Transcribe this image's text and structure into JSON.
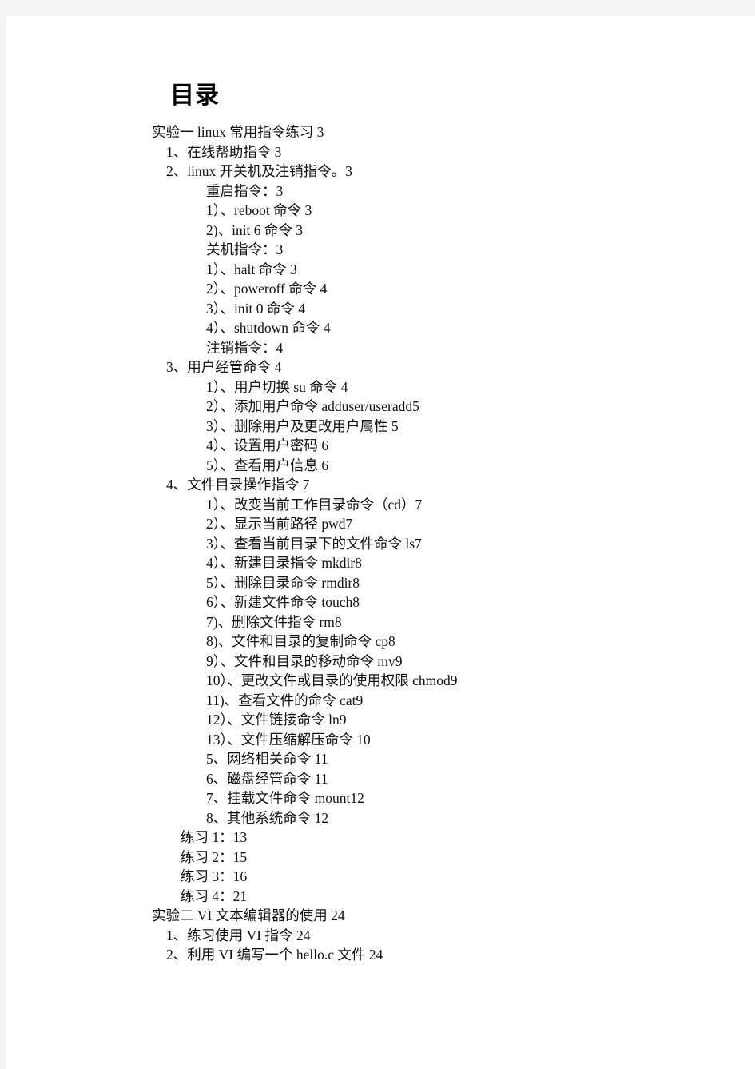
{
  "document": {
    "title": "目录"
  },
  "toc": {
    "entries": [
      {
        "level": 1,
        "text": "实验一 linux 常用指令练习 3"
      },
      {
        "level": 2,
        "text": "1、在线帮助指令 3"
      },
      {
        "level": 2,
        "text": "2、linux 开关机及注销指令。3"
      },
      {
        "level": 3,
        "text": "重启指令：3"
      },
      {
        "level": 3,
        "text": "1）、reboot 命令 3"
      },
      {
        "level": 3,
        "text": "2)、init 6 命令 3"
      },
      {
        "level": 3,
        "text": "关机指令：3"
      },
      {
        "level": 3,
        "text": "1）、halt 命令 3"
      },
      {
        "level": 3,
        "text": "2）、poweroff 命令 4"
      },
      {
        "level": 3,
        "text": "3）、init 0 命令 4"
      },
      {
        "level": 3,
        "text": "4）、shutdown 命令 4"
      },
      {
        "level": 3,
        "text": "注销指令：4"
      },
      {
        "level": 2,
        "text": "3、用户经管命令 4"
      },
      {
        "level": 3,
        "text": "1）、用户切换 su 命令 4"
      },
      {
        "level": 3,
        "text": "2）、添加用户命令 adduser/useradd5"
      },
      {
        "level": 3,
        "text": "3）、删除用户及更改用户属性 5"
      },
      {
        "level": 3,
        "text": "4）、设置用户密码 6"
      },
      {
        "level": 3,
        "text": "5）、查看用户信息 6"
      },
      {
        "level": 2,
        "text": "4、文件目录操作指令 7"
      },
      {
        "level": 3,
        "text": "1）、改变当前工作目录命令（cd）7"
      },
      {
        "level": 3,
        "text": "2）、显示当前路径 pwd7"
      },
      {
        "level": 3,
        "text": "3）、查看当前目录下的文件命令 ls7"
      },
      {
        "level": 3,
        "text": "4）、新建目录指令 mkdir8"
      },
      {
        "level": 3,
        "text": "5）、删除目录命令 rmdir8"
      },
      {
        "level": 3,
        "text": "6）、新建文件命令 touch8"
      },
      {
        "level": 3,
        "text": "7)、删除文件指令 rm8"
      },
      {
        "level": 3,
        "text": "8)、文件和目录的复制命令 cp8"
      },
      {
        "level": 3,
        "text": "9）、文件和目录的移动命令 mv9"
      },
      {
        "level": 3,
        "text": "10）、更改文件或目录的使用权限 chmod9"
      },
      {
        "level": 3,
        "text": "11)、查看文件的命令 cat9"
      },
      {
        "level": 3,
        "text": "12）、文件链接命令 ln9"
      },
      {
        "level": 3,
        "text": "13）、文件压缩解压命令 10"
      },
      {
        "level": 3,
        "text": "5、网络相关命令 11"
      },
      {
        "level": 3,
        "text": "6、磁盘经管命令 11"
      },
      {
        "level": 3,
        "text": "7、挂载文件命令 mount12"
      },
      {
        "level": 3,
        "text": "8、其他系统命令 12"
      },
      {
        "level": 4,
        "text": "练习 1：13"
      },
      {
        "level": 4,
        "text": "练习 2：15"
      },
      {
        "level": 4,
        "text": "练习 3：16"
      },
      {
        "level": 4,
        "text": "练习 4：21"
      },
      {
        "level": 1,
        "text": "实验二 VI 文本编辑器的使用 24"
      },
      {
        "level": 2,
        "text": "1、练习使用 VI 指令 24"
      },
      {
        "level": 2,
        "text": "2、利用 VI 编写一个 hello.c 文件 24"
      }
    ]
  }
}
